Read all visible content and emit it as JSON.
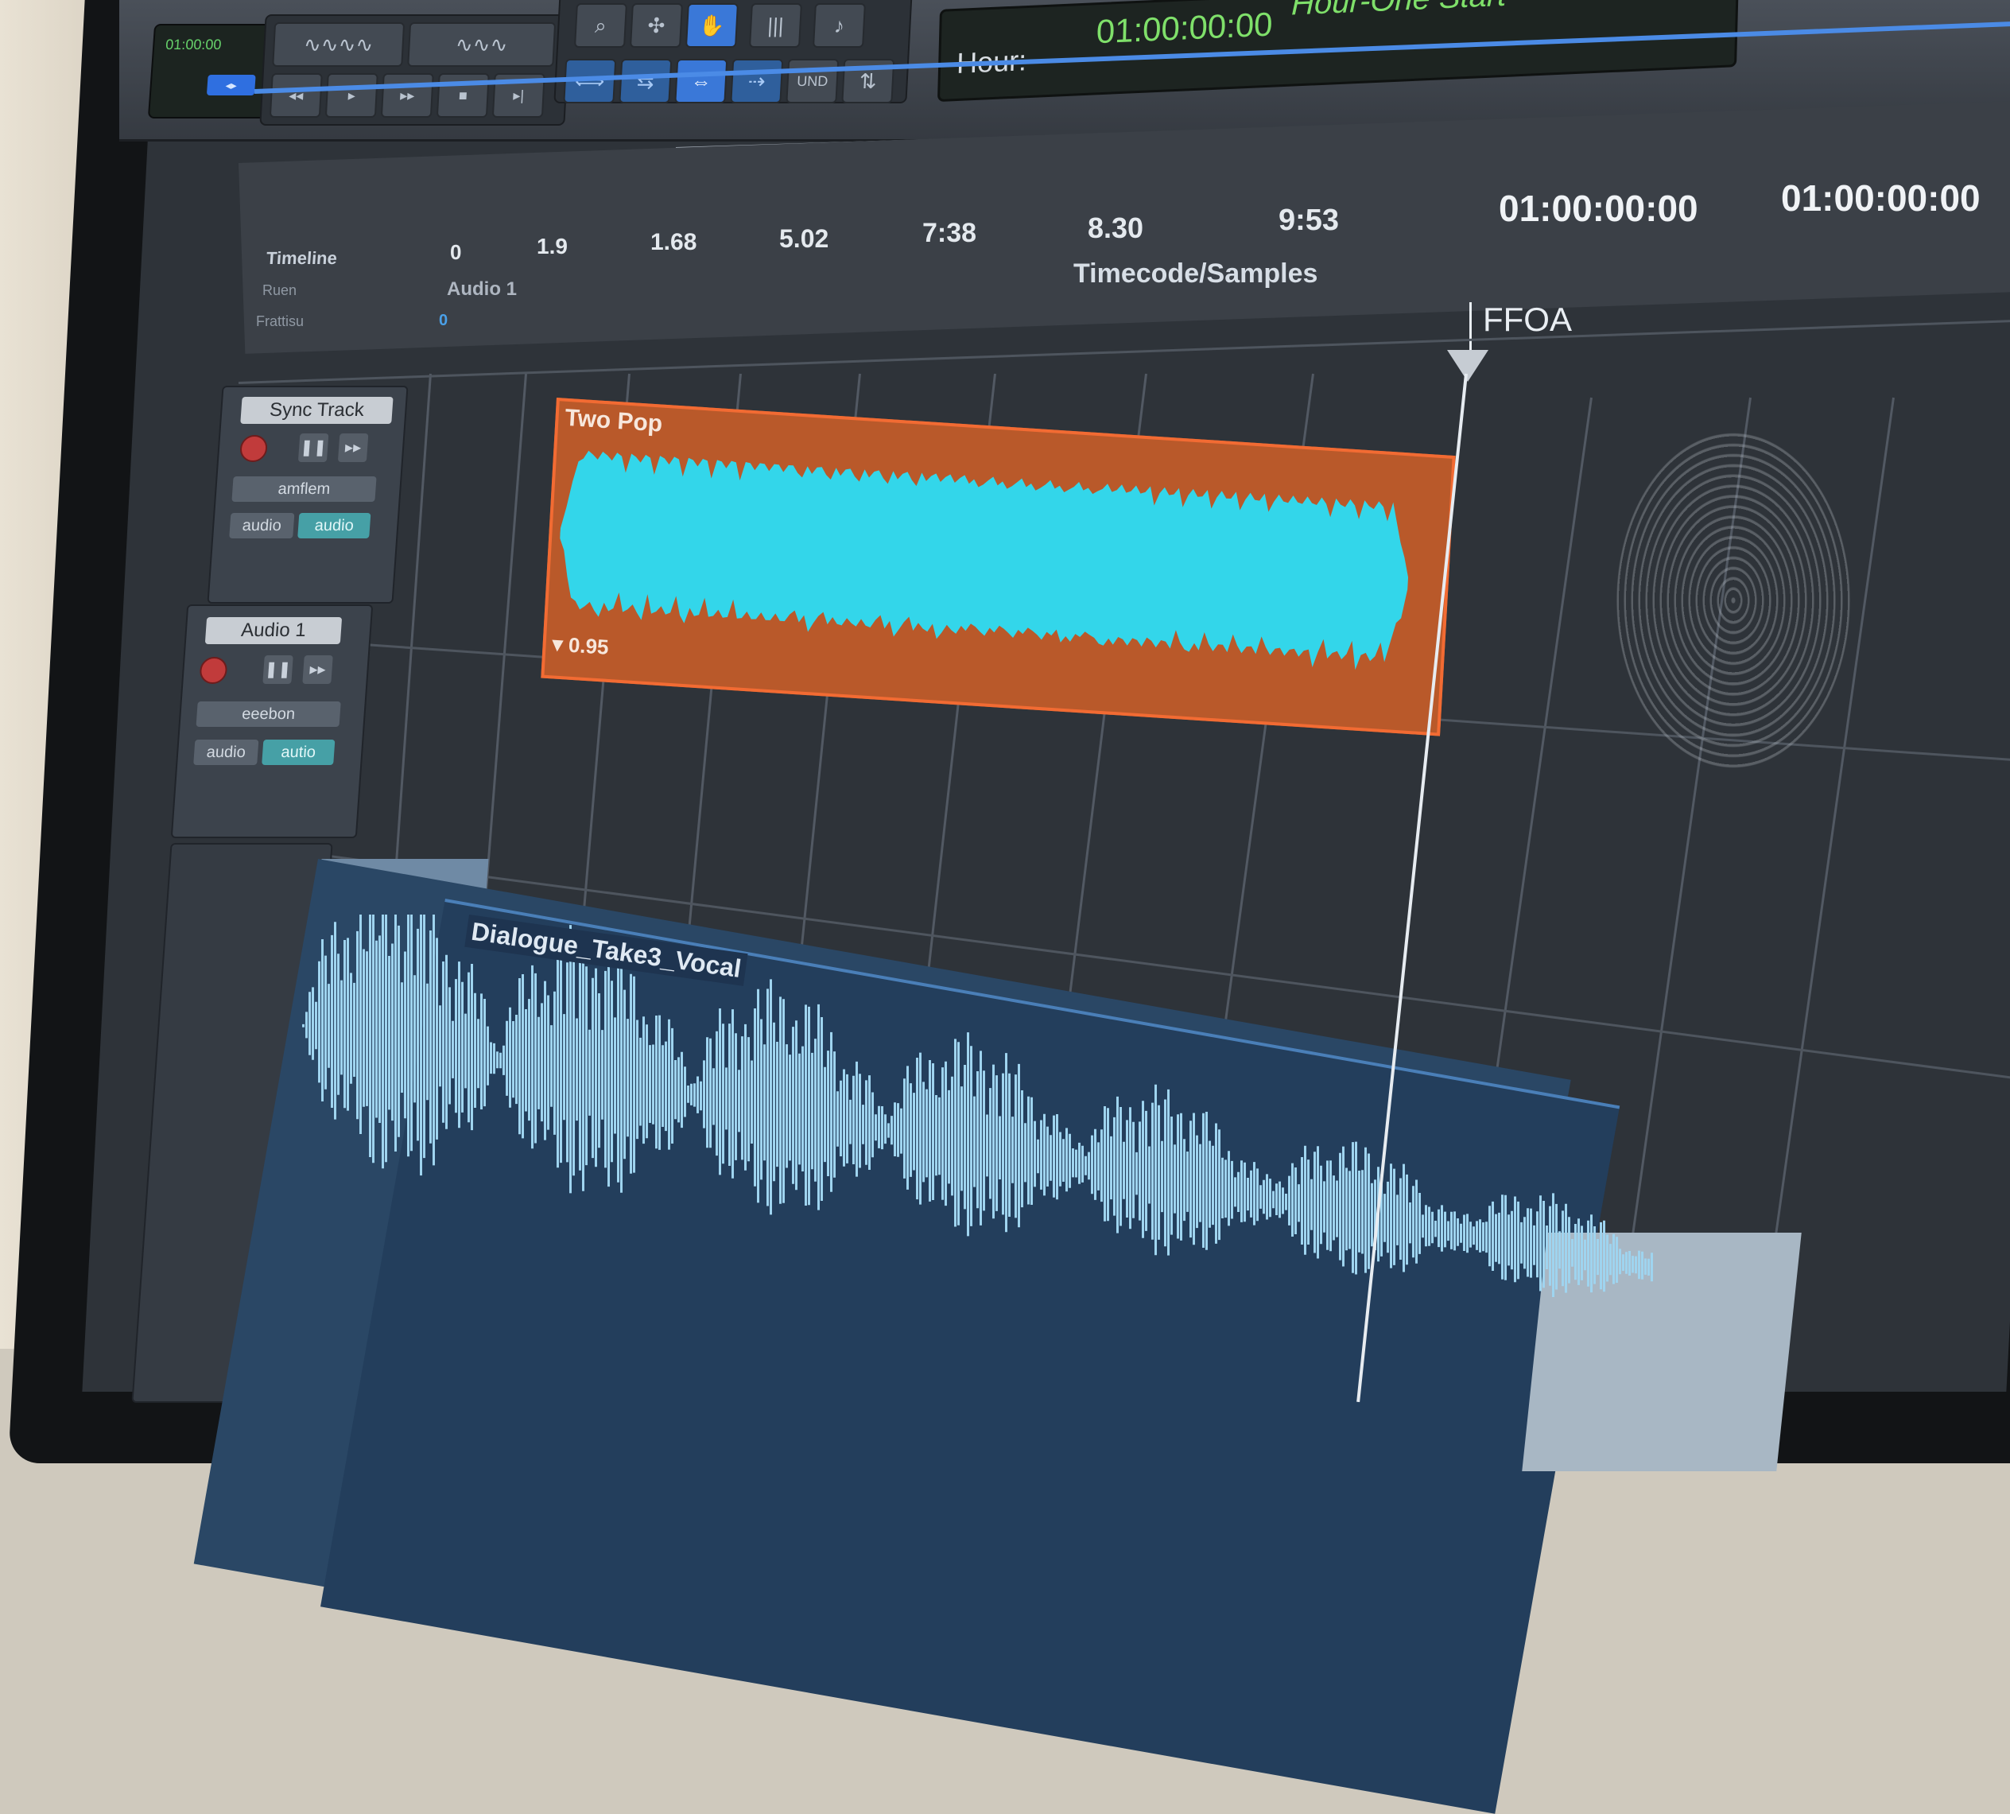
{
  "transport": {
    "counter_mini": "01:00:00",
    "counter_pill": "◂▸",
    "clock_label": "Hour:",
    "clock_value": "01:00:00:00",
    "clock_start": "Hour-One Start"
  },
  "rulers": {
    "timeline": "Timeline",
    "ruler2": "Ruen",
    "ruler3": "Frattisu",
    "timecode_samples": "Timecode/Samples",
    "audio_track_label": "Audio 1",
    "zero": "0",
    "ticks": [
      "0",
      "1.9",
      "1.68",
      "5.02",
      "7:38",
      "8.30",
      "9:53"
    ],
    "timecodes": [
      "01:00:00:00",
      "01:00:00:00"
    ],
    "marker": "FFOA"
  },
  "tracks": [
    {
      "name": "Sync Track",
      "mode": "amflem",
      "input": "audio",
      "output": "audio"
    },
    {
      "name": "Audio 1",
      "mode": "eeebon",
      "input": "audio",
      "output": "autio"
    }
  ],
  "clips": {
    "two_pop": {
      "name": "Two Pop",
      "gain": "▾ 0.95"
    },
    "dialogue": {
      "name": "Dialogue_Take3_Vocal"
    }
  },
  "colors": {
    "pop_clip_fill": "#b9592a",
    "pop_clip_border": "#f26b33",
    "pop_wave": "#33d6ea",
    "dialogue_wave": "#9fd4ef",
    "accent_blue": "#3a78d8",
    "clock_green": "#7fe06a"
  },
  "icons": [
    "waveform-icon",
    "zoom-icon",
    "smart-tool-icon",
    "grabber-icon",
    "trim-icon",
    "link-icon",
    "loop-icon",
    "undo-icon",
    "record-icon",
    "pause-icon",
    "play-icon"
  ]
}
